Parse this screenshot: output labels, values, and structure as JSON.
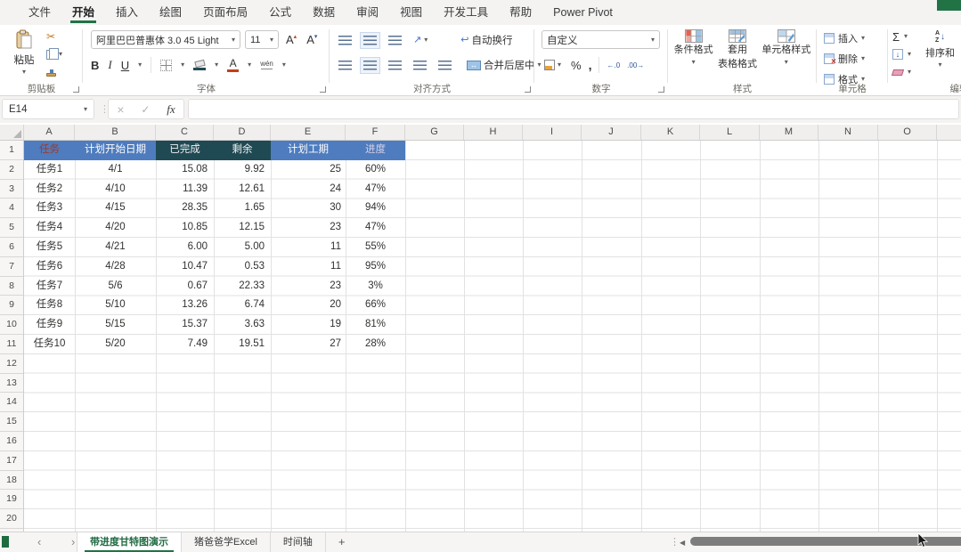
{
  "colors": {
    "accent_green": "#217346",
    "table_header_blue": "#4e7cbe",
    "table_header_dark_teal": "#1f4a54",
    "task_header_text": "#9e3a2a",
    "fill_color_bar": "#1f4a54",
    "font_color_bar": "#c43e1c"
  },
  "icons": {
    "dropdown": "▾",
    "caret_up": "▴",
    "scissors": "✂",
    "sum": "Σ",
    "down_arrow": "↓",
    "wrap_return": "↩",
    "orientation_arrow": "↗",
    "merge_arrows": "↔",
    "close": "×",
    "check": "✓",
    "chevron_left": "‹",
    "chevron_right": "›",
    "dots_vertical": "⋮",
    "scroll_left": "◀",
    "sort_a": "A",
    "sort_z": "Z"
  },
  "menu": {
    "active_tab": "开始",
    "tabs": [
      "文件",
      "开始",
      "插入",
      "绘图",
      "页面布局",
      "公式",
      "数据",
      "审阅",
      "视图",
      "开发工具",
      "帮助",
      "Power Pivot"
    ]
  },
  "ribbon": {
    "clipboard": {
      "group_label": "剪贴板",
      "paste_label": "粘贴"
    },
    "font": {
      "group_label": "字体",
      "font_name": "阿里巴巴普惠体 3.0 45 Light",
      "font_size": "11",
      "bold": "B",
      "italic": "I",
      "underline": "U",
      "grow_font": "A",
      "shrink_font": "A",
      "pinyin": "wén"
    },
    "alignment": {
      "group_label": "对齐方式",
      "wrap_text": "自动换行",
      "merge_center": "合并后居中"
    },
    "number": {
      "group_label": "数字",
      "format_value": "自定义",
      "percent": "%",
      "thousands": ",",
      "inc_decimal": "←.0",
      "dec_decimal": ".00→"
    },
    "styles": {
      "group_label": "样式",
      "conditional": "条件格式",
      "format_table_line1": "套用",
      "format_table_line2": "表格格式",
      "cell_styles": "单元格样式"
    },
    "cells": {
      "group_label": "单元格",
      "insert": "插入",
      "delete": "删除",
      "format": "格式"
    },
    "editing": {
      "group_label": "编辑",
      "sort_label": "排序和"
    }
  },
  "formula_bar": {
    "name_box": "E14",
    "fx_label": "fx",
    "formula_value": ""
  },
  "grid": {
    "col_letters": [
      "A",
      "B",
      "C",
      "D",
      "E",
      "F",
      "G",
      "H",
      "I",
      "J",
      "K",
      "L",
      "M",
      "N",
      "O"
    ],
    "row_numbers": [
      "1",
      "2",
      "3",
      "4",
      "5",
      "6",
      "7",
      "8",
      "9",
      "10",
      "11",
      "12",
      "13",
      "14",
      "15",
      "16",
      "17",
      "18",
      "19",
      "20"
    ]
  },
  "table": {
    "headers": [
      "任务",
      "计划开始日期",
      "已完成",
      "剩余",
      "计划工期",
      "进度"
    ],
    "rows": [
      [
        "任务1",
        "4/1",
        "15.08",
        "9.92",
        "25",
        "60%"
      ],
      [
        "任务2",
        "4/10",
        "11.39",
        "12.61",
        "24",
        "47%"
      ],
      [
        "任务3",
        "4/15",
        "28.35",
        "1.65",
        "30",
        "94%"
      ],
      [
        "任务4",
        "4/20",
        "10.85",
        "12.15",
        "23",
        "47%"
      ],
      [
        "任务5",
        "4/21",
        "6.00",
        "5.00",
        "11",
        "55%"
      ],
      [
        "任务6",
        "4/28",
        "10.47",
        "0.53",
        "11",
        "95%"
      ],
      [
        "任务7",
        "5/6",
        "0.67",
        "22.33",
        "23",
        "3%"
      ],
      [
        "任务8",
        "5/10",
        "13.26",
        "6.74",
        "20",
        "66%"
      ],
      [
        "任务9",
        "5/15",
        "15.37",
        "3.63",
        "19",
        "81%"
      ],
      [
        "任务10",
        "5/20",
        "7.49",
        "19.51",
        "27",
        "28%"
      ]
    ]
  },
  "sheet_tabs": {
    "active": "带进度甘特图演示",
    "tabs": [
      "带进度甘特图演示",
      "猪爸爸学Excel",
      "时间轴"
    ],
    "add_label": "+"
  }
}
